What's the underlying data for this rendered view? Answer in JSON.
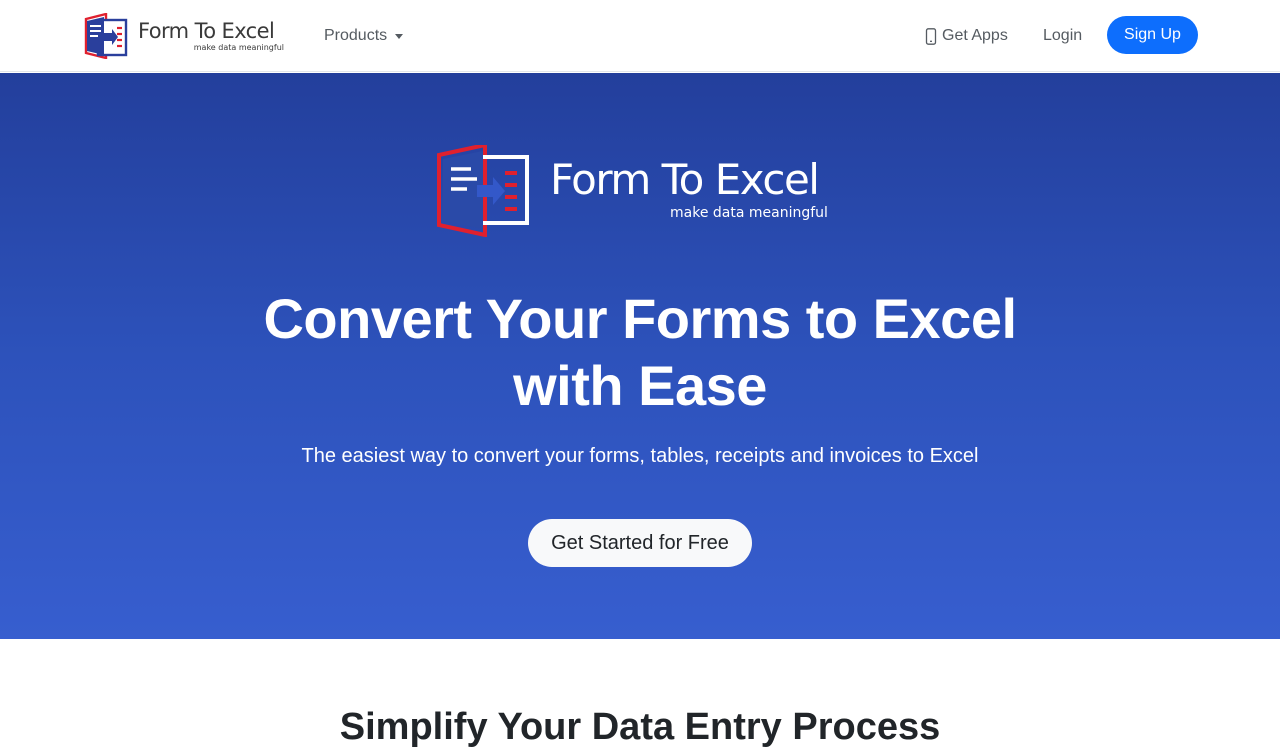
{
  "brand": {
    "name": "Form To Excel",
    "tagline": "make data meaningful",
    "colors": {
      "red": "#e0202e",
      "blue": "#2a3f9c"
    }
  },
  "nav": {
    "products_label": "Products",
    "get_apps_label": "Get Apps",
    "login_label": "Login",
    "signup_label": "Sign Up",
    "icons": {
      "products": "chevron-down-icon",
      "apps": "mobile-phone-icon"
    }
  },
  "hero": {
    "logo_name": "Form To Excel",
    "logo_tagline": "make data meaningful",
    "title_line1": "Convert Your Forms to Excel",
    "title_line2": "with Ease",
    "subtitle": "The easiest way to convert your forms, tables, receipts and invoices to Excel",
    "cta_label": "Get Started for Free",
    "gradient": {
      "top": "#233f9c",
      "bottom": "#375ecf"
    }
  },
  "accent_color": "#0d6efd",
  "next_section": {
    "heading": "Simplify Your Data Entry Process"
  }
}
